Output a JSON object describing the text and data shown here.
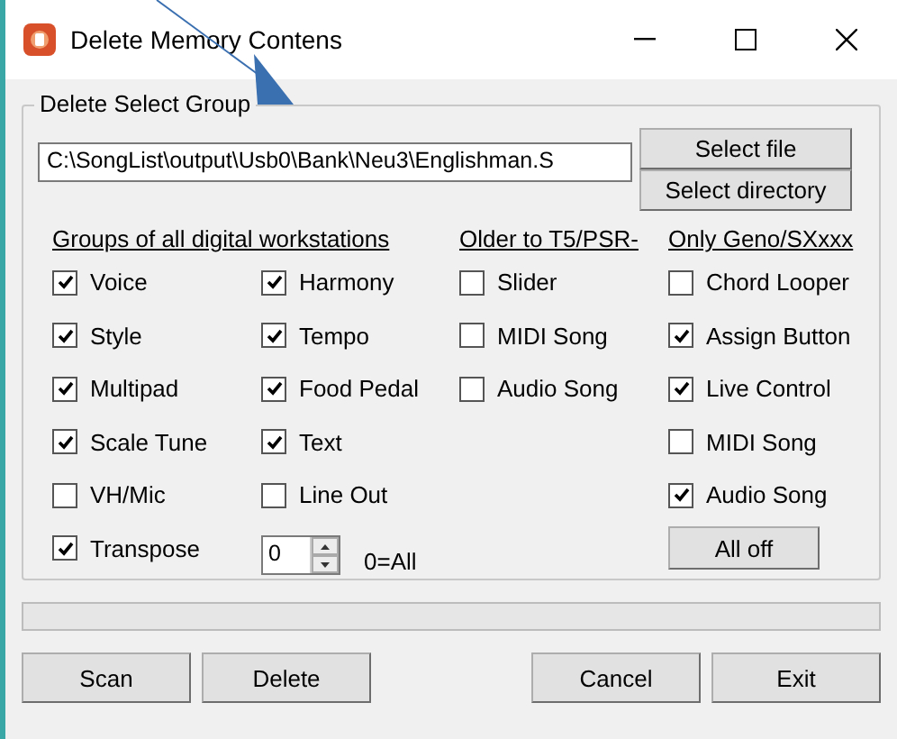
{
  "window": {
    "title": "Delete Memory Contens"
  },
  "group": {
    "title": "Delete Select Group",
    "path_field": {
      "value": "C:\\SongList\\output\\Usb0\\Bank\\Neu3\\Englishman.S"
    },
    "file_buttons": [
      "Select file",
      "Select directory"
    ],
    "sections": [
      {
        "heading": "Groups of all digital workstations",
        "columns": [
          [
            {
              "kind": "checkbox",
              "label": "Voice",
              "checked": true
            },
            {
              "kind": "checkbox",
              "label": "Style",
              "checked": true
            },
            {
              "kind": "checkbox",
              "label": "Multipad",
              "checked": true
            },
            {
              "kind": "checkbox",
              "label": "Scale Tune",
              "checked": true
            },
            {
              "kind": "checkbox",
              "label": "VH/Mic",
              "checked": false
            },
            {
              "kind": "checkbox",
              "label": "Transpose",
              "checked": true
            }
          ],
          [
            {
              "kind": "checkbox",
              "label": "Harmony",
              "checked": true
            },
            {
              "kind": "checkbox",
              "label": "Tempo",
              "checked": true
            },
            {
              "kind": "checkbox",
              "label": "Food Pedal",
              "checked": true
            },
            {
              "kind": "checkbox",
              "label": "Text",
              "checked": true
            },
            {
              "kind": "checkbox",
              "label": "Line Out",
              "checked": false
            },
            {
              "kind": "spinner",
              "value": "0",
              "hint": "0=All"
            }
          ]
        ]
      },
      {
        "heading": "Older to T5/PSR-",
        "columns": [
          [
            {
              "kind": "checkbox",
              "label": "Slider",
              "checked": false
            },
            {
              "kind": "checkbox",
              "label": "MIDI Song",
              "checked": false
            },
            {
              "kind": "checkbox",
              "label": "Audio Song",
              "checked": false
            }
          ]
        ]
      },
      {
        "heading": "Only Geno/SXxxx",
        "columns": [
          [
            {
              "kind": "checkbox",
              "label": "Chord Looper",
              "checked": false
            },
            {
              "kind": "checkbox",
              "label": "Assign Button",
              "checked": true
            },
            {
              "kind": "checkbox",
              "label": "Live Control",
              "checked": true
            },
            {
              "kind": "checkbox",
              "label": "MIDI Song",
              "checked": false
            },
            {
              "kind": "checkbox",
              "label": "Audio Song",
              "checked": true
            },
            {
              "kind": "button",
              "label": "All off"
            }
          ]
        ]
      }
    ]
  },
  "buttons": [
    "Scan",
    "Delete",
    "Cancel",
    "Exit"
  ]
}
